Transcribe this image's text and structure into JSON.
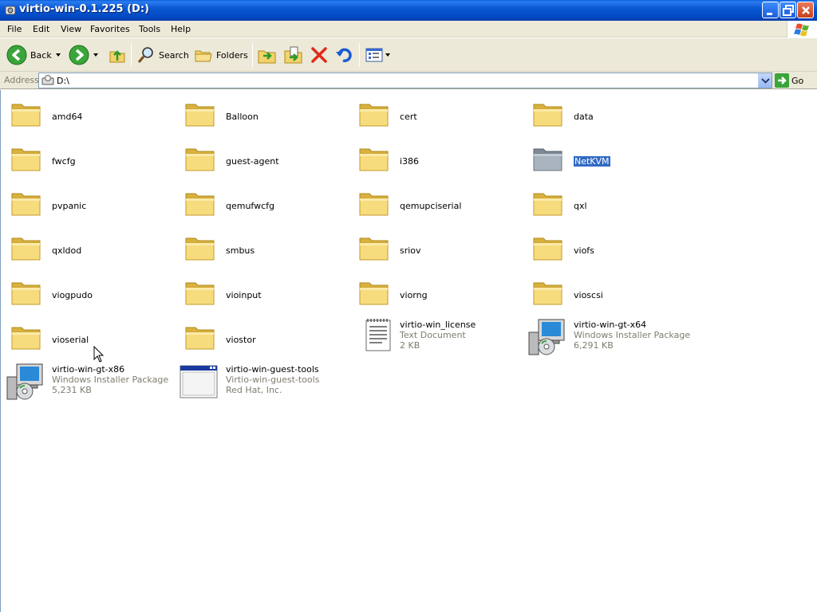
{
  "window": {
    "title": "virtio-win-0.1.225 (D:)"
  },
  "menu": [
    "File",
    "Edit",
    "View",
    "Favorites",
    "Tools",
    "Help"
  ],
  "toolbar": {
    "back_label": "Back",
    "search_label": "Search",
    "folders_label": "Folders"
  },
  "address": {
    "label": "Address",
    "value": "D:\\",
    "go_label": "Go"
  },
  "items": [
    {
      "name": "amd64",
      "type": "folder"
    },
    {
      "name": "Balloon",
      "type": "folder"
    },
    {
      "name": "cert",
      "type": "folder"
    },
    {
      "name": "data",
      "type": "folder"
    },
    {
      "name": "fwcfg",
      "type": "folder"
    },
    {
      "name": "guest-agent",
      "type": "folder"
    },
    {
      "name": "i386",
      "type": "folder"
    },
    {
      "name": "NetKVM",
      "type": "folder",
      "selected": true
    },
    {
      "name": "pvpanic",
      "type": "folder"
    },
    {
      "name": "qemufwcfg",
      "type": "folder"
    },
    {
      "name": "qemupciserial",
      "type": "folder"
    },
    {
      "name": "qxl",
      "type": "folder"
    },
    {
      "name": "qxldod",
      "type": "folder"
    },
    {
      "name": "smbus",
      "type": "folder"
    },
    {
      "name": "sriov",
      "type": "folder"
    },
    {
      "name": "viofs",
      "type": "folder"
    },
    {
      "name": "viogpudo",
      "type": "folder"
    },
    {
      "name": "vioinput",
      "type": "folder"
    },
    {
      "name": "viorng",
      "type": "folder"
    },
    {
      "name": "vioscsi",
      "type": "folder"
    },
    {
      "name": "vioserial",
      "type": "folder"
    },
    {
      "name": "viostor",
      "type": "folder"
    },
    {
      "name": "virtio-win_license",
      "type": "text",
      "line2": "Text Document",
      "line3": "2 KB"
    },
    {
      "name": "virtio-win-gt-x64",
      "type": "msi",
      "line2": "Windows Installer Package",
      "line3": "6,291 KB"
    },
    {
      "name": "virtio-win-gt-x86",
      "type": "msi",
      "line2": "Windows Installer Package",
      "line3": "5,231 KB"
    },
    {
      "name": "virtio-win-guest-tools",
      "type": "exe",
      "line2": "Virtio-win-guest-tools",
      "line3": "Red Hat, Inc."
    }
  ]
}
